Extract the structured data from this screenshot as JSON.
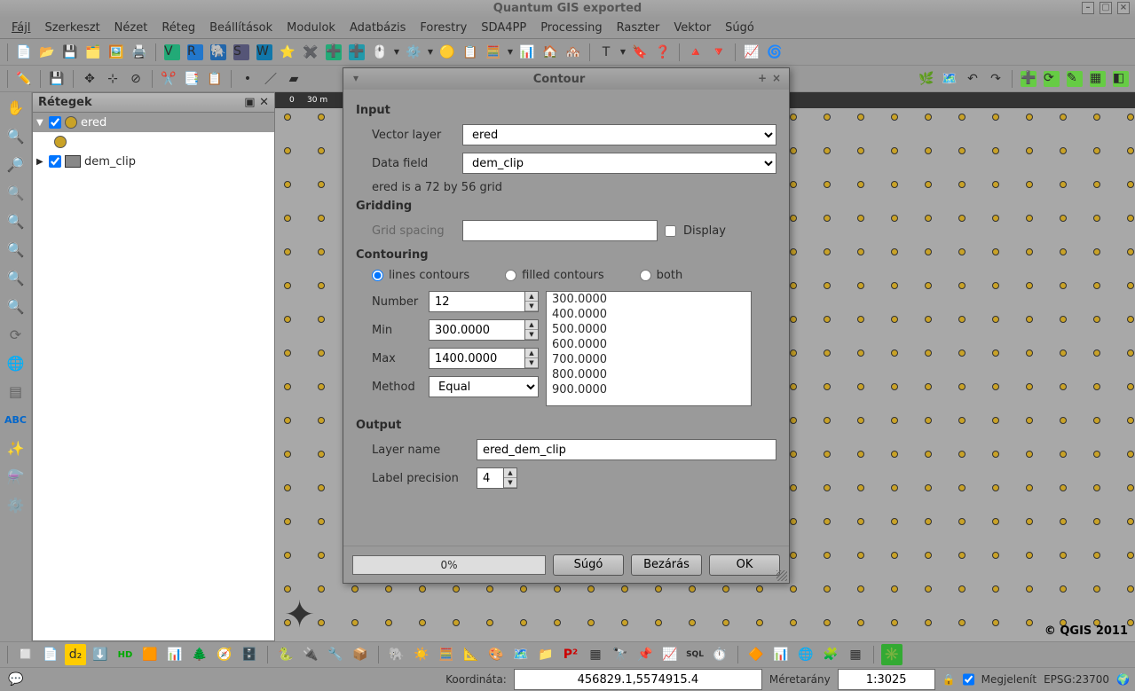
{
  "window": {
    "title": "Quantum GIS exported"
  },
  "menu": [
    "Fájl",
    "Szerkeszt",
    "Nézet",
    "Réteg",
    "Beállítások",
    "Modulok",
    "Adatbázis",
    "Forestry",
    "SDA4PP",
    "Processing",
    "Raszter",
    "Vektor",
    "Súgó"
  ],
  "panels": {
    "layers": {
      "title": "Rétegek",
      "items": [
        {
          "name": "ered",
          "checked": true,
          "expanded": true,
          "selected": true,
          "type": "point"
        },
        {
          "name": "dem_clip",
          "checked": true,
          "expanded": false,
          "selected": false,
          "type": "raster"
        }
      ]
    }
  },
  "canvas": {
    "ruler_start": "0",
    "ruler_step": "30",
    "ruler_unit": "m",
    "copyright": "© QGIS 2011"
  },
  "statusbar": {
    "coord_label": "Koordináta:",
    "coord_value": "456829.1,5574915.4",
    "scale_label": "Méretarány",
    "scale_value": "1:3025",
    "render_label": "Megjelenít",
    "render_checked": true,
    "crs": "EPSG:23700"
  },
  "dialog": {
    "title": "Contour",
    "sections": {
      "input": {
        "heading": "Input",
        "vector_label": "Vector layer",
        "vector_value": "ered",
        "field_label": "Data field",
        "field_value": "dem_clip",
        "grid_info": "ered is a 72 by 56 grid"
      },
      "gridding": {
        "heading": "Gridding",
        "spacing_label": "Grid spacing",
        "spacing_value": "",
        "display_label": "Display",
        "display_checked": false
      },
      "contouring": {
        "heading": "Contouring",
        "mode_options": {
          "lines": "lines contours",
          "filled": "filled contours",
          "both": "both"
        },
        "mode_selected": "lines",
        "number_label": "Number",
        "number_value": "12",
        "min_label": "Min",
        "min_value": "300.0000",
        "max_label": "Max",
        "max_value": "1400.0000",
        "method_label": "Method",
        "method_value": "Equal",
        "levels": [
          "300.0000",
          "400.0000",
          "500.0000",
          "600.0000",
          "700.0000",
          "800.0000",
          "900.0000"
        ]
      },
      "output": {
        "heading": "Output",
        "name_label": "Layer name",
        "name_value": "ered_dem_clip",
        "prec_label": "Label precision",
        "prec_value": "4"
      }
    },
    "footer": {
      "progress": "0%",
      "help": "Súgó",
      "close": "Bezárás",
      "ok": "OK"
    }
  }
}
